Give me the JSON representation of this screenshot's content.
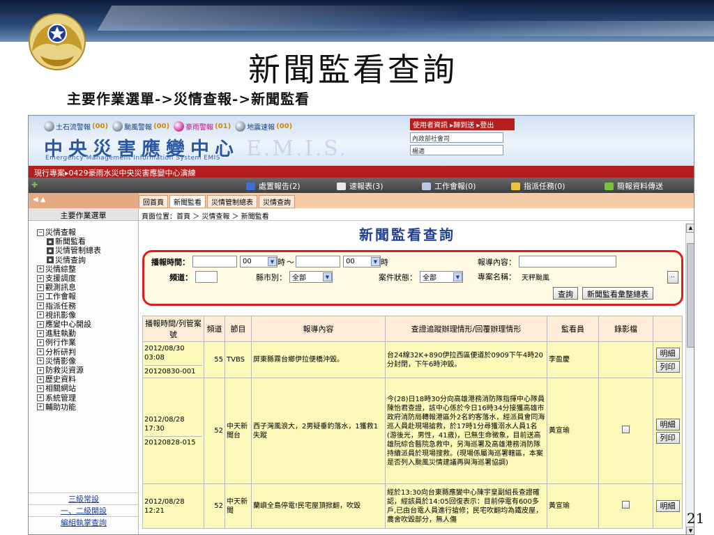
{
  "slide": {
    "title": "新聞監看查詢",
    "subtitle": "主要作業選單->災情查報->新聞監看",
    "page_number": "21"
  },
  "header": {
    "alerts": [
      {
        "label": "土石流警報",
        "count": "(00)",
        "icon": "orb-icon",
        "active": false
      },
      {
        "label": "颱風警報",
        "count": "(00)",
        "icon": "orb-icon",
        "active": false
      },
      {
        "label": "豪雨警報",
        "count": "(01)",
        "icon": "orb-pink-icon",
        "active": true
      },
      {
        "label": "地震速報",
        "count": "(00)",
        "icon": "orb-icon",
        "active": false
      }
    ],
    "brand_cn": "中央災害應變中心",
    "brand_en": "Emergency Management Information System EMIS",
    "brand_mark": "E.M.I.S.",
    "user_bar": [
      "使用者資訊",
      "▸歸到送",
      "▸登出"
    ],
    "user_org": "內政部社會司",
    "user_name": "楊適",
    "project_line": "現行專案▸0429豪雨水災中央災害應變中心演練"
  },
  "toolbar": {
    "items": [
      {
        "label": "處置報告(2)",
        "icon": "report-icon",
        "color": "#3d6fd0"
      },
      {
        "label": "速報表(3)",
        "icon": "pencil-icon",
        "color": "#e8e8e8"
      },
      {
        "label": "工作會報(0)",
        "icon": "pen-icon",
        "color": "#b8c8e8"
      },
      {
        "label": "指派任務(0)",
        "icon": "task-icon",
        "color": "#f2c23a"
      },
      {
        "label": "簡報資料傳送",
        "icon": "upload-icon",
        "color": "#7ac043"
      }
    ]
  },
  "nav": {
    "tabs": [
      "回首頁",
      "新聞監看",
      "災情管制總表",
      "災情查詢"
    ]
  },
  "sidebar": {
    "header": "主要作業選單",
    "tree": [
      {
        "label": "災情查報",
        "kind": "minus",
        "level": 0
      },
      {
        "label": "新聞監看",
        "kind": "page",
        "level": 1
      },
      {
        "label": "災情管制總表",
        "kind": "page",
        "level": 1
      },
      {
        "label": "災情查詢",
        "kind": "page",
        "level": 1
      },
      {
        "label": "災情綜整",
        "kind": "plus",
        "level": 0
      },
      {
        "label": "支援調度",
        "kind": "plus",
        "level": 0
      },
      {
        "label": "觀測訊息",
        "kind": "plus",
        "level": 0
      },
      {
        "label": "工作會報",
        "kind": "plus",
        "level": 0
      },
      {
        "label": "指派任務",
        "kind": "plus",
        "level": 0
      },
      {
        "label": "視訊影像",
        "kind": "plus",
        "level": 0
      },
      {
        "label": "應變中心開設",
        "kind": "plus",
        "level": 0
      },
      {
        "label": "進駐執勤",
        "kind": "plus",
        "level": 0
      },
      {
        "label": "例行作業",
        "kind": "plus",
        "level": 0
      },
      {
        "label": "分析研判",
        "kind": "plus",
        "level": 0
      },
      {
        "label": "災情影像",
        "kind": "plus",
        "level": 0
      },
      {
        "label": "防救災資源",
        "kind": "plus",
        "level": 0
      },
      {
        "label": "歷史資料",
        "kind": "plus",
        "level": 0
      },
      {
        "label": "相關網站",
        "kind": "plus",
        "level": 0
      },
      {
        "label": "系統管理",
        "kind": "plus",
        "level": 0
      },
      {
        "label": "輔助功能",
        "kind": "plus",
        "level": 0
      }
    ],
    "links": [
      "三級常設",
      "一、二級開設",
      "編組執掌查詢"
    ]
  },
  "main": {
    "breadcrumb": "頁面位置：首頁 ＞ 災情查報 ＞ 新聞監看",
    "title": "新聞監看查詢"
  },
  "search": {
    "broadcast_time_label": "播報時間：",
    "start_date": "",
    "start_hour": "00",
    "hour_unit": "時",
    "range_sep": "～",
    "end_date": "",
    "end_hour": "00",
    "hour_unit2": "時",
    "content_label": "報導內容：",
    "content_value": "",
    "channel_label": "頻道：",
    "channel_value": "",
    "county_label": "縣市別：",
    "county_value": "全部",
    "status_label": "案件狀態：",
    "status_value": "全部",
    "project_label": "專案名稱：",
    "project_value": "天秤颱風",
    "browse_button": "..",
    "query_button": "查詢",
    "export_button": "新聞監看彙整總表"
  },
  "table": {
    "columns": [
      "播報時間/列管案號",
      "頻道",
      "節目",
      "報導內容",
      "查證追蹤辦理情形/回覆辦理情形",
      "監看員",
      "錄影檔",
      ""
    ],
    "rows": [
      {
        "time": "2012/08/30 03:08",
        "case_no": "20120830-001",
        "channel": "55",
        "program": "TVBS",
        "content": "屏東縣霧台鄉伊拉便橋沖毀。",
        "followup": "台24線32K+890伊拉西區便道於0909下午4時20分封閉，下午6時沖毀。",
        "monitor": "李盈慶",
        "video": false,
        "actions": [
          "明細",
          "列印"
        ]
      },
      {
        "time": "2012/08/28 17:30",
        "case_no": "20120828-015",
        "channel": "52",
        "program": "中天新聞台",
        "content": "西子灣風浪大，2男疑垂釣落水，1獲救1失蹤",
        "followup": "今(28)日18時30分向高雄港務消防隊指揮中心隊員陳怡君查證，該中心係於今日16時34分接獲高雄市政府消防局轉報港區外2名釣客落水，經派員會同海巡人員赴現場搶救，於17時1分尋獲溺水人員1名(游後光，男性，41歲)，已無生命徵象，目前送高雄阮綜合醫院急救中，另海巡署及高雄港務消防隊持續派員於現場搜救。(現場係屬海巡署轄區，本案是否列入颱風災情建議再與海巡署協調)",
        "monitor": "黃宣瑜",
        "video": true,
        "actions": [
          "明細",
          "列印"
        ]
      },
      {
        "time": "2012/08/28 12:21",
        "case_no": "",
        "channel": "52",
        "program": "中天新聞",
        "content": "蘭嶼全島停電!民宅屋頂掀翻，吹毀",
        "followup": "經於13:30向台東縣應變中心陳宇皇副組長查證確認，經該員於14:05回復表示：目前停電有600多戶,已由台電人員進行搶修；民宅吹翻均為鐵皮屋，農舍吹毀部分，無人傷",
        "monitor": "黃宣瑜",
        "video": true,
        "actions": [
          "明細"
        ]
      }
    ]
  }
}
